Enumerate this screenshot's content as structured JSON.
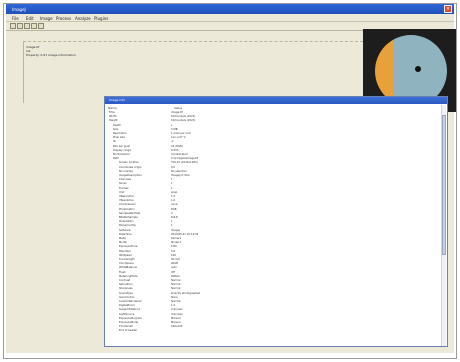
{
  "window": {
    "title": "ImageJ"
  },
  "menu": [
    "File",
    "Edit",
    "Image",
    "Process",
    "Analyze",
    "Plugins"
  ],
  "toolbar": {
    "tools": [
      "rectangle-tool",
      "oval-tool",
      "polygon-tool",
      "line-tool",
      "text-tool"
    ]
  },
  "workspace_notes": [
    "image.tif",
    "1/1",
    "Property: 0.97 image information"
  ],
  "image": {
    "description": "circular specimen, orange rim left, blue-grey center, black dot"
  },
  "dialog": {
    "title": "Image Info",
    "columns": [
      "Name",
      "Value"
    ],
    "rows": [
      {
        "k": "Title",
        "v": "image.tif"
      },
      {
        "k": "Width",
        "v": "1024 pixels (1024)"
      },
      {
        "k": "Height",
        "v": "1024 pixels (1024)"
      },
      {
        "k": "Depth",
        "v": "1"
      },
      {
        "k": "Size",
        "v": "3 MB"
      },
      {
        "k": "Resolution",
        "v": "1 pixel per unit"
      },
      {
        "k": "Pixel size",
        "v": "1x1 unit^2"
      },
      {
        "k": "ID",
        "v": "-2"
      },
      {
        "k": "Bits per pixel",
        "v": "24 (RGB)"
      },
      {
        "k": "Display range",
        "v": "0-255"
      },
      {
        "k": "No threshold",
        "v": "Uncalibrated"
      },
      {
        "k": "Path",
        "v": "C:\\\\Images\\\\image.tif"
      },
      {
        "k": "Screen location",
        "v": "370,32 (1024x1024)"
      },
      {
        "k": "Coordinate origin",
        "v": "0,0"
      },
      {
        "k": "No overlay",
        "v": "No selection"
      },
      {
        "k": "ImageDescription",
        "v": "ImageJ=1.52a"
      },
      {
        "k": "Channels",
        "v": "1"
      },
      {
        "k": "Slices",
        "v": "1"
      },
      {
        "k": "Frames",
        "v": "1"
      },
      {
        "k": "Unit",
        "v": "pixel"
      },
      {
        "k": "XResolution",
        "v": "1.0"
      },
      {
        "k": "YResolution",
        "v": "1.0"
      },
      {
        "k": "Compression",
        "v": "none"
      },
      {
        "k": "Photometric",
        "v": "RGB"
      },
      {
        "k": "SamplesPerPixel",
        "v": "3"
      },
      {
        "k": "BitsPerSample",
        "v": "8,8,8"
      },
      {
        "k": "Orientation",
        "v": "1"
      },
      {
        "k": "PlanarConfig",
        "v": "1"
      },
      {
        "k": "Software",
        "v": "ImageJ"
      },
      {
        "k": "DateTime",
        "v": "2019:05:21 10:14:02"
      },
      {
        "k": "Make",
        "v": "Camera"
      },
      {
        "k": "Model",
        "v": "Model X"
      },
      {
        "k": "ExposureTime",
        "v": "1/60"
      },
      {
        "k": "FNumber",
        "v": "5.6"
      },
      {
        "k": "ISOSpeed",
        "v": "100"
      },
      {
        "k": "FocalLength",
        "v": "50 mm"
      },
      {
        "k": "ColorSpace",
        "v": "sRGB"
      },
      {
        "k": "WhiteBalance",
        "v": "Auto"
      },
      {
        "k": "Flash",
        "v": "Off"
      },
      {
        "k": "MeteringMode",
        "v": "Pattern"
      },
      {
        "k": "Contrast",
        "v": "Normal"
      },
      {
        "k": "Saturation",
        "v": "Normal"
      },
      {
        "k": "Sharpness",
        "v": "Normal"
      },
      {
        "k": "SceneType",
        "v": "Directly photographed"
      },
      {
        "k": "GainControl",
        "v": "None"
      },
      {
        "k": "CustomRendered",
        "v": "Normal"
      },
      {
        "k": "DigitalZoom",
        "v": "1.0"
      },
      {
        "k": "SubjectDistance",
        "v": "Unknown"
      },
      {
        "k": "LightSource",
        "v": "Unknown"
      },
      {
        "k": "ExposureProgram",
        "v": "Manual"
      },
      {
        "k": "ExposureMode",
        "v": "Manual"
      },
      {
        "k": "Thumbnail",
        "v": "160x120"
      },
      {
        "k": "End of header",
        "v": ""
      }
    ]
  }
}
